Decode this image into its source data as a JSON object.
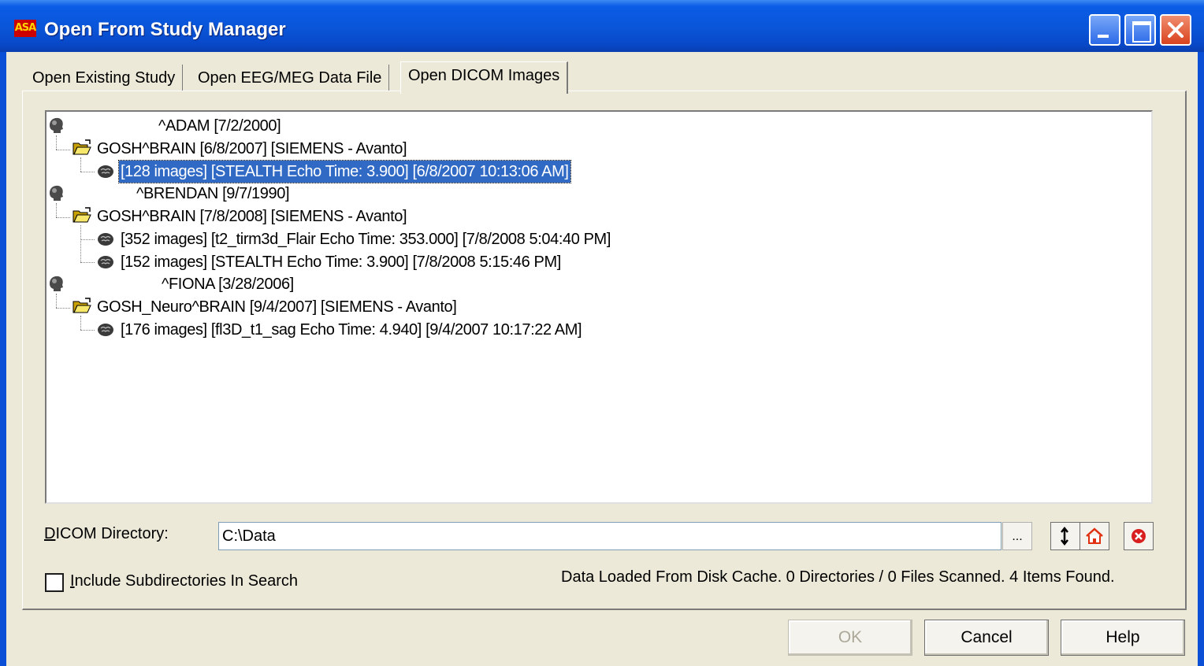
{
  "window": {
    "title": "Open From Study Manager",
    "app_icon_text": "ASA"
  },
  "tabs": [
    {
      "label": "Open Existing Study"
    },
    {
      "label": "Open EEG/MEG Data File"
    },
    {
      "label": "Open DICOM Images",
      "active": true
    }
  ],
  "tree": {
    "patients": [
      {
        "label": "^ADAM [7/2/2000]",
        "study": "GOSH^BRAIN [6/8/2007]  [SIEMENS - Avanto]",
        "series": [
          "[128 images] [STEALTH Echo Time: 3.900] [6/8/2007 10:13:06 AM]"
        ]
      },
      {
        "label": "^BRENDAN [9/7/1990]",
        "study": "GOSH^BRAIN [7/8/2008]  [SIEMENS - Avanto]",
        "series": [
          "[352 images] [t2_tirm3d_Flair Echo Time: 353.000] [7/8/2008 5:04:40 PM]",
          "[152 images] [STEALTH Echo Time: 3.900] [7/8/2008 5:15:46 PM]"
        ]
      },
      {
        "label": "^FIONA [3/28/2006]",
        "study": "GOSH_Neuro^BRAIN [9/4/2007]  [SIEMENS - Avanto]",
        "series": [
          "[176 images] [fl3D_t1_sag Echo Time: 4.940] [9/4/2007 10:17:22 AM]"
        ]
      }
    ],
    "selected": "[128 images] [STEALTH Echo Time: 3.900] [6/8/2007 10:13:06 AM]"
  },
  "directory": {
    "label_first": "D",
    "label_rest": "ICOM Directory:",
    "value": "C:\\Data",
    "browse_label": "..."
  },
  "checkbox": {
    "label_first": "I",
    "label_rest": "nclude Subdirectories In Search",
    "checked": false
  },
  "status": "Data Loaded From Disk Cache. 0 Directories / 0 Files Scanned. 4 Items Found.",
  "buttons": {
    "ok": "OK",
    "cancel": "Cancel",
    "help": "Help"
  },
  "icons": {
    "patient": "head-icon",
    "study": "open-folder-icon",
    "series": "brain-icon",
    "refresh": "refresh-icon",
    "home": "home-icon",
    "remove": "remove-icon"
  },
  "colors": {
    "titlebar": "#0a55d8",
    "selection": "#316ac5",
    "dialog_bg": "#ece9d8"
  }
}
